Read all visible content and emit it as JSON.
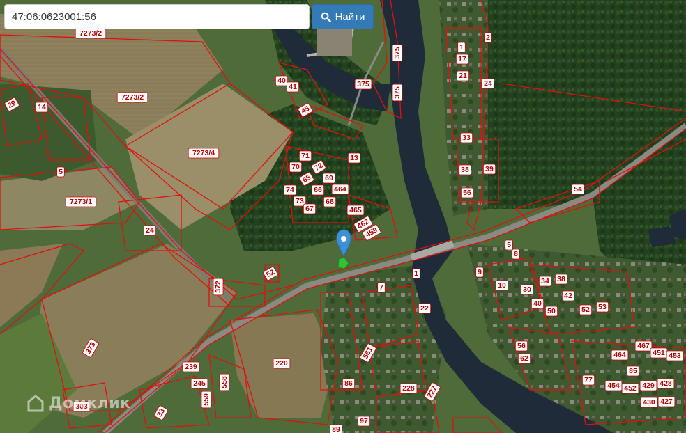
{
  "search": {
    "value": "47:06:0623001:56"
  },
  "search_button": {
    "label": "Найти",
    "icon": "search-icon"
  },
  "watermark": {
    "text": "Домклик"
  },
  "marker": {
    "icon": "map-pin-icon",
    "color": "#3d8fd6"
  },
  "colors": {
    "parcel_border": "#e01010",
    "label_text": "#b00000",
    "button": "#337ab7"
  },
  "parcel_labels": [
    {
      "text": "7273/2"
    },
    {
      "text": "7273/2"
    },
    {
      "text": "7273/4"
    },
    {
      "text": "7273/1"
    },
    {
      "text": "375"
    },
    {
      "text": "375"
    },
    {
      "text": "375"
    },
    {
      "text": "2"
    },
    {
      "text": "1"
    },
    {
      "text": "17"
    },
    {
      "text": "21"
    },
    {
      "text": "24"
    },
    {
      "text": "33"
    },
    {
      "text": "38"
    },
    {
      "text": "39"
    },
    {
      "text": "56"
    },
    {
      "text": "54"
    },
    {
      "text": "5"
    },
    {
      "text": "8"
    },
    {
      "text": "9"
    },
    {
      "text": "10"
    },
    {
      "text": "30"
    },
    {
      "text": "34"
    },
    {
      "text": "38"
    },
    {
      "text": "40"
    },
    {
      "text": "42"
    },
    {
      "text": "50"
    },
    {
      "text": "52"
    },
    {
      "text": "53"
    },
    {
      "text": "56"
    },
    {
      "text": "62"
    },
    {
      "text": "464"
    },
    {
      "text": "467"
    },
    {
      "text": "451"
    },
    {
      "text": "453"
    },
    {
      "text": "85"
    },
    {
      "text": "77"
    },
    {
      "text": "454"
    },
    {
      "text": "452"
    },
    {
      "text": "429"
    },
    {
      "text": "428"
    },
    {
      "text": "430"
    },
    {
      "text": "427"
    },
    {
      "text": "40"
    },
    {
      "text": "41"
    },
    {
      "text": "45"
    },
    {
      "text": "13"
    },
    {
      "text": "71"
    },
    {
      "text": "72"
    },
    {
      "text": "70"
    },
    {
      "text": "69"
    },
    {
      "text": "65"
    },
    {
      "text": "464"
    },
    {
      "text": "74"
    },
    {
      "text": "66"
    },
    {
      "text": "73"
    },
    {
      "text": "68"
    },
    {
      "text": "67"
    },
    {
      "text": "465"
    },
    {
      "text": "462"
    },
    {
      "text": "459"
    },
    {
      "text": "52"
    },
    {
      "text": "1"
    },
    {
      "text": "7"
    },
    {
      "text": "22"
    },
    {
      "text": "561"
    },
    {
      "text": "86"
    },
    {
      "text": "228"
    },
    {
      "text": "227"
    },
    {
      "text": "97"
    },
    {
      "text": "89"
    },
    {
      "text": "220"
    },
    {
      "text": "239"
    },
    {
      "text": "245"
    },
    {
      "text": "558"
    },
    {
      "text": "559"
    },
    {
      "text": "33"
    },
    {
      "text": "303"
    },
    {
      "text": "373"
    },
    {
      "text": "372"
    },
    {
      "text": "24"
    },
    {
      "text": "5"
    },
    {
      "text": "29"
    },
    {
      "text": "14"
    }
  ]
}
